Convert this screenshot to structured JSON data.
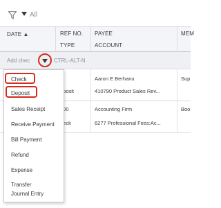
{
  "filter": {
    "label": "All"
  },
  "header": {
    "date": "DATE ▲",
    "ref_no": "REF NO.",
    "type": "TYPE",
    "payee": "PAYEE",
    "account": "ACCOUNT",
    "memo": "MEM"
  },
  "add_row": {
    "label": "Add chec",
    "shortcut": "CTRL-ALT-N"
  },
  "rows": [
    {
      "ref": "",
      "payee": "Aaron E Berhanu",
      "memo": "Sup"
    },
    {
      "ref": "eposit",
      "payee": "410790 Product Sales Rev...",
      "memo": ""
    },
    {
      "ref": "000",
      "payee": "Accounting Firm",
      "memo": "Boo"
    },
    {
      "ref": "heck",
      "payee": "6277 Professional Fees:Ac...",
      "memo": ""
    }
  ],
  "menu": {
    "items": [
      "Check",
      "Deposit",
      "Sales Receipt",
      "Receive Payment",
      "Bill Payment",
      "Refund",
      "Expense",
      "Transfer",
      "Journal Entry"
    ]
  },
  "colors": {
    "highlight": "#d52b1e",
    "header_bg": "#f4f5f8"
  }
}
